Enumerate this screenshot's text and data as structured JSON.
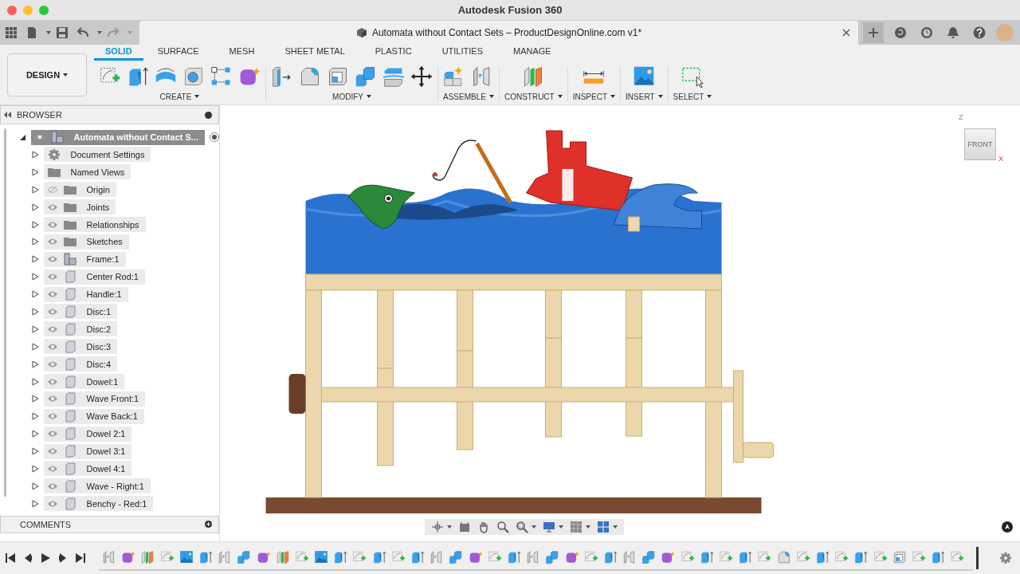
{
  "window": {
    "title": "Autodesk Fusion 360"
  },
  "document_tab": {
    "title": "Automata without Contact Sets – ProductDesignOnline.com v1*"
  },
  "workspace": {
    "label": "DESIGN"
  },
  "tabs": [
    {
      "label": "SOLID",
      "selected": true
    },
    {
      "label": "SURFACE",
      "selected": false
    },
    {
      "label": "MESH",
      "selected": false
    },
    {
      "label": "SHEET METAL",
      "selected": false
    },
    {
      "label": "PLASTIC",
      "selected": false
    },
    {
      "label": "UTILITIES",
      "selected": false
    },
    {
      "label": "MANAGE",
      "selected": false
    }
  ],
  "tool_groups": [
    {
      "label": "CREATE",
      "kind": "create"
    },
    {
      "label": "MODIFY",
      "kind": "modify"
    },
    {
      "label": "ASSEMBLE",
      "kind": "assemble"
    },
    {
      "label": "CONSTRUCT",
      "kind": "construct"
    },
    {
      "label": "INSPECT",
      "kind": "inspect"
    },
    {
      "label": "INSERT",
      "kind": "insert"
    },
    {
      "label": "SELECT",
      "kind": "select"
    }
  ],
  "browser": {
    "title": "BROWSER",
    "tree": [
      {
        "label": "Automata without Contact S...",
        "kind": "component",
        "visible": true,
        "selected": true,
        "expanded": true,
        "children": [
          {
            "label": "Document Settings",
            "kind": "settings",
            "selected": false,
            "expanded": false
          },
          {
            "label": "Named Views",
            "kind": "views",
            "selected": false,
            "expanded": false
          },
          {
            "label": "Origin",
            "kind": "folder",
            "visible": false,
            "selected": false,
            "expanded": false
          },
          {
            "label": "Joints",
            "kind": "folder",
            "visible": true,
            "selected": false,
            "expanded": false
          },
          {
            "label": "Relationships",
            "kind": "folder",
            "visible": true,
            "selected": false,
            "expanded": false
          },
          {
            "label": "Sketches",
            "kind": "folder",
            "visible": true,
            "selected": false,
            "expanded": false
          },
          {
            "label": "Frame:1",
            "kind": "component",
            "visible": true,
            "selected": false,
            "expanded": false
          },
          {
            "label": "Center Rod:1",
            "kind": "body",
            "visible": true,
            "selected": false,
            "expanded": false
          },
          {
            "label": "Handle:1",
            "kind": "body",
            "visible": true,
            "selected": false,
            "expanded": false
          },
          {
            "label": "Disc:1",
            "kind": "body",
            "visible": true,
            "selected": false,
            "expanded": false
          },
          {
            "label": "Disc:2",
            "kind": "body",
            "visible": true,
            "selected": false,
            "expanded": false
          },
          {
            "label": "Disc:3",
            "kind": "body",
            "visible": true,
            "selected": false,
            "expanded": false
          },
          {
            "label": "Disc:4",
            "kind": "body",
            "visible": true,
            "selected": false,
            "expanded": false
          },
          {
            "label": "Dowel:1",
            "kind": "body",
            "visible": true,
            "selected": false,
            "expanded": false
          },
          {
            "label": "Wave Front:1",
            "kind": "body",
            "visible": true,
            "selected": false,
            "expanded": false
          },
          {
            "label": "Wave Back:1",
            "kind": "body",
            "visible": true,
            "selected": false,
            "expanded": false
          },
          {
            "label": "Dowel 2:1",
            "kind": "body",
            "visible": true,
            "selected": false,
            "expanded": false
          },
          {
            "label": "Dowel 3:1",
            "kind": "body",
            "visible": true,
            "selected": false,
            "expanded": false
          },
          {
            "label": "Dowel 4:1",
            "kind": "body",
            "visible": true,
            "selected": false,
            "expanded": false
          },
          {
            "label": "Wave - Right:1",
            "kind": "body",
            "visible": true,
            "selected": false,
            "expanded": false
          },
          {
            "label": "Benchy - Red:1",
            "kind": "body",
            "visible": true,
            "selected": false,
            "expanded": false
          }
        ]
      }
    ]
  },
  "comments": {
    "title": "COMMENTS"
  },
  "viewcube": {
    "face": "FRONT",
    "axis_up": "Z",
    "axis_right": "X"
  }
}
